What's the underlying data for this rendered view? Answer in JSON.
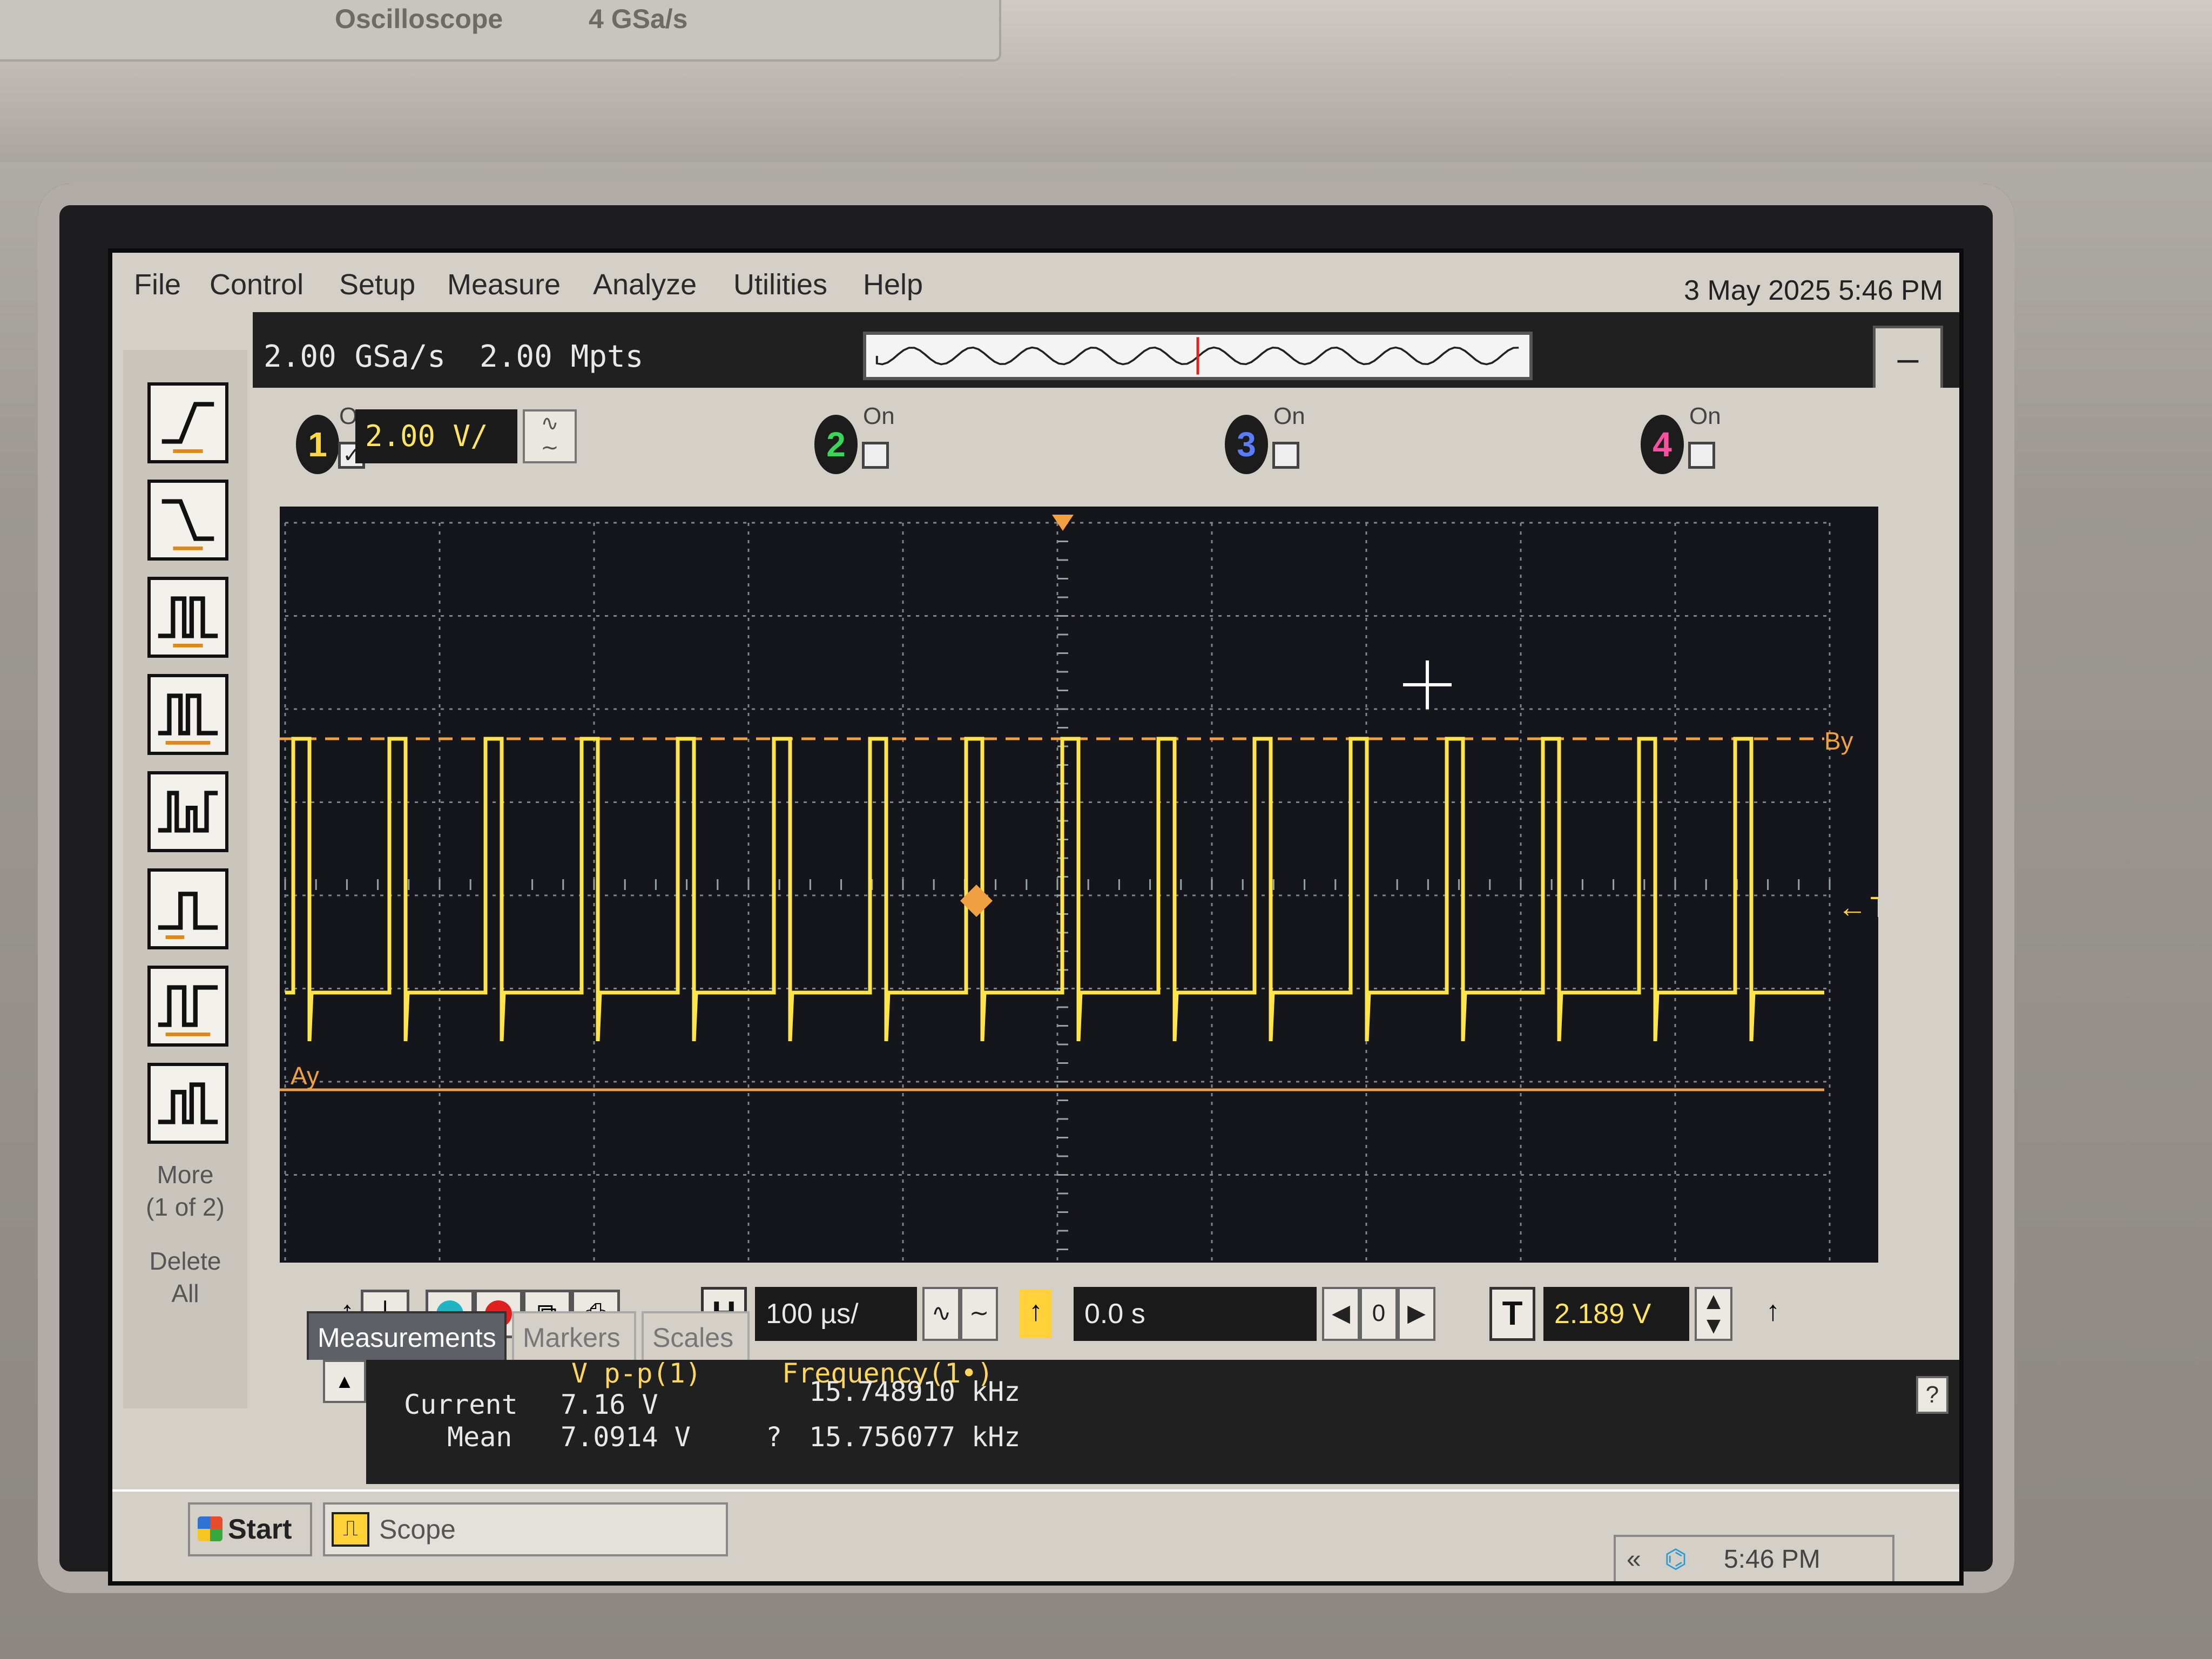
{
  "brand": {
    "name": "Oscilloscope",
    "rate": "4 GSa/s"
  },
  "menu": [
    "File",
    "Control",
    "Setup",
    "Measure",
    "Analyze",
    "Utilities",
    "Help"
  ],
  "datetime": "3 May 2025  5:46 PM",
  "acquisition": {
    "sample_rate": "2.00 GSa/s",
    "memory": "2.00 Mpts"
  },
  "channels": [
    {
      "num": "1",
      "on_label": "On",
      "checked": "✓",
      "scale": "2.00 V/",
      "color": "#ffd83a"
    },
    {
      "num": "2",
      "on_label": "On",
      "checked": "",
      "color": "#39d65a"
    },
    {
      "num": "3",
      "on_label": "On",
      "checked": "",
      "color": "#5a7cff"
    },
    {
      "num": "4",
      "on_label": "On",
      "checked": "",
      "color": "#ff4fa0"
    }
  ],
  "markers": {
    "a": "Ay",
    "b": "By",
    "trigger": "T"
  },
  "timebase": {
    "h_label": "H",
    "scale": "100 µs/",
    "delay": "0.0 s",
    "zero": "0"
  },
  "trigger": {
    "t_label": "T",
    "level": "2.189 V"
  },
  "sidebar": {
    "more": "More",
    "more_page": "(1 of 2)",
    "delete": "Delete",
    "delete_all": "All"
  },
  "tabs": [
    "Measurements",
    "Markers",
    "Scales"
  ],
  "measurements": {
    "col1_header": "V p-p(1)",
    "col2_header": "Frequency(1•)",
    "current_label": "Current",
    "mean_label": "Mean",
    "vpp_current": "7.16 V",
    "vpp_mean": "7.0914 V",
    "freq_current": "15.748910 kHz",
    "freq_mean_prefix": "?",
    "freq_mean": "15.756077 kHz",
    "help": "?"
  },
  "taskbar": {
    "start": "Start",
    "app": "Scope",
    "time": "5:46 PM"
  },
  "colors": {
    "trace": "#ffe44a",
    "marker": "#f0a040",
    "grid": "#8a8f98",
    "screen_bg": "#15161c"
  }
}
